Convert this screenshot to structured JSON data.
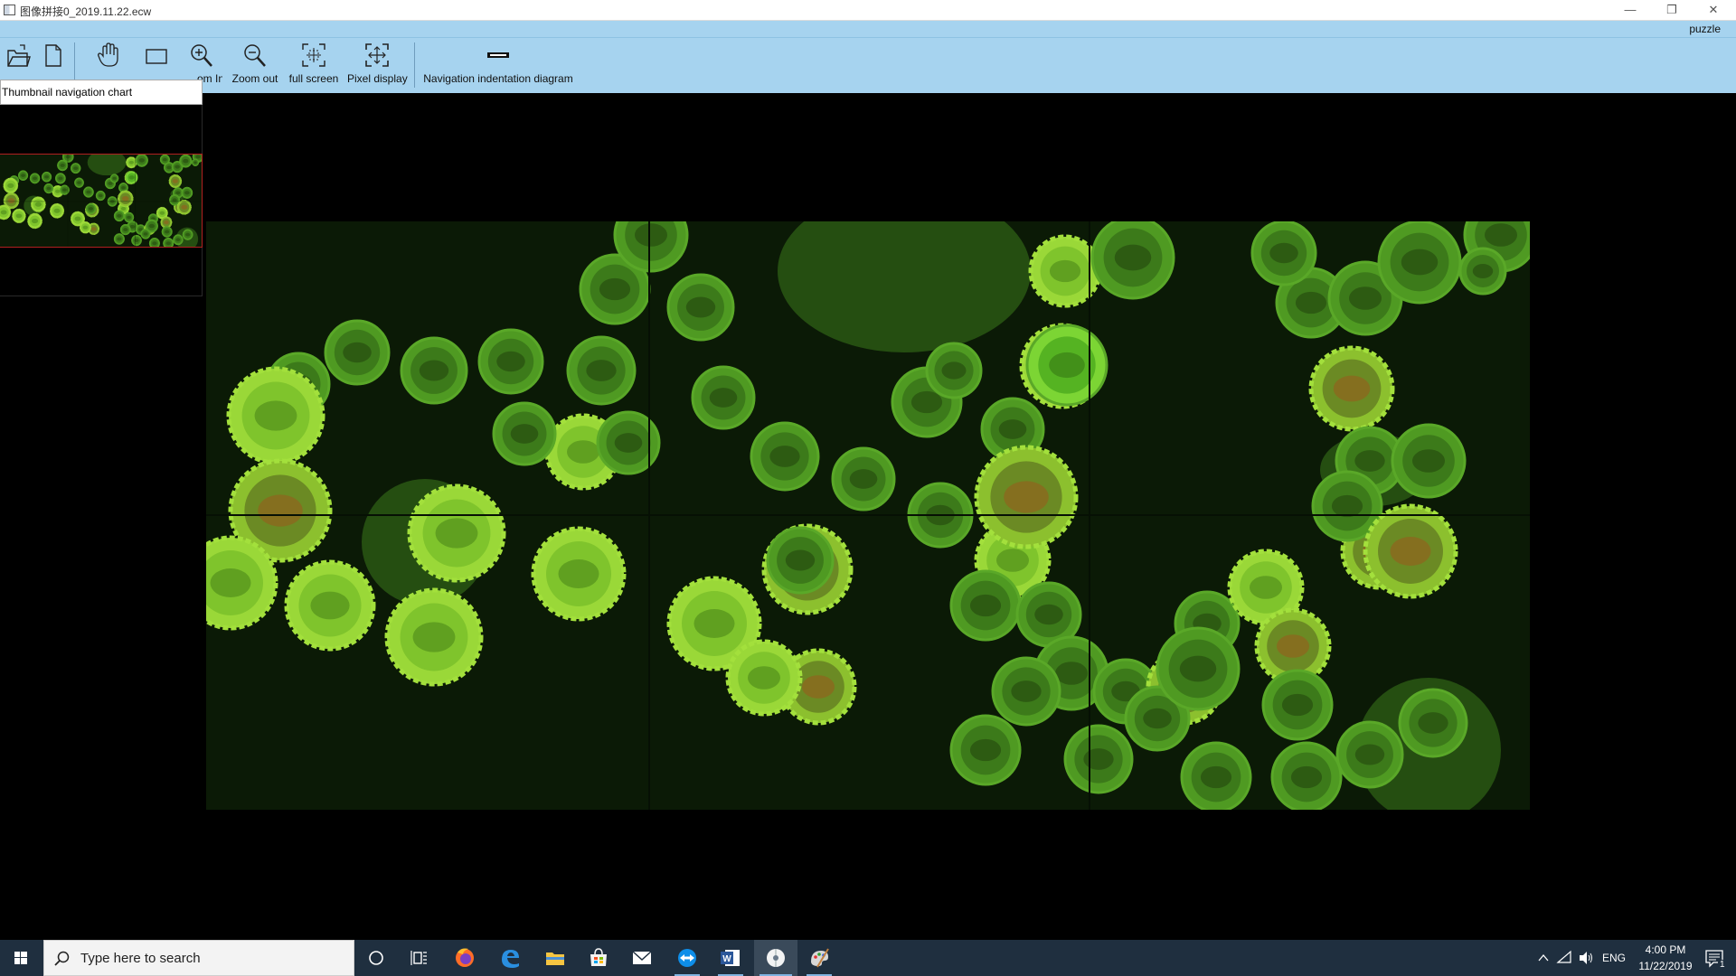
{
  "window": {
    "title": "图像拼接0_2019.11.22.ecw",
    "minimize": "—",
    "maximize": "❐",
    "close": "✕"
  },
  "menu": {
    "right_label": "puzzle"
  },
  "toolbar": {
    "open_label": "Open",
    "save_label": "Save",
    "pan_label": "Pan",
    "select_label": "Select",
    "zoom_in_label": "Zoom In",
    "zoom_out_label": "Zoom out",
    "full_screen_label": "full screen",
    "pixel_display_label": "Pixel display",
    "nav_diagram_label": "Navigation indentation diagram"
  },
  "thumbnail": {
    "header": "Thumbnail navigation chart"
  },
  "taskbar": {
    "search_placeholder": "Type here to search",
    "language": "ENG",
    "time": "4:00 PM",
    "date": "11/22/2019",
    "notification_count": "1",
    "apps": [
      "start-icon",
      "cortana-icon",
      "task-view-icon",
      "firefox-icon",
      "edge-icon",
      "file-explorer-icon",
      "store-icon",
      "mail-icon",
      "teamviewer-icon",
      "word-icon",
      "app-disc-icon",
      "paint-icon"
    ]
  },
  "colors": {
    "toolbar_bg": "#a6d3ef",
    "taskbar_bg": "#1f2f3f",
    "image_bg": "#000000",
    "cell_bright": "#8ccf2a",
    "cell_dark": "#2f5a14"
  }
}
